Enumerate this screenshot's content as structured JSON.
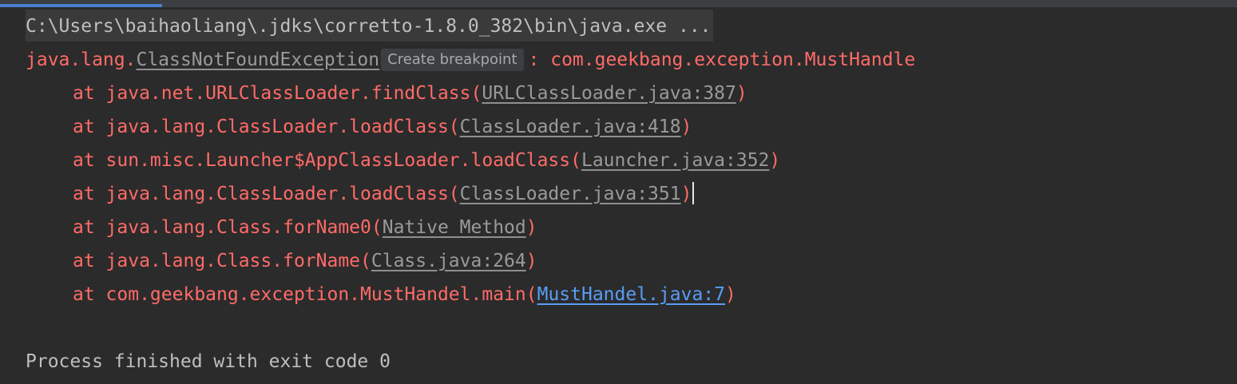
{
  "console": {
    "command_line": "C:\\Users\\baihaoliang\\.jdks\\corretto-1.8.0_382\\bin\\java.exe ...",
    "exception": {
      "package_prefix": "java.lang.",
      "class_link": "ClassNotFoundException",
      "breakpoint_hint": "Create breakpoint",
      "message": ": com.geekbang.exception.MustHandle"
    },
    "stack": [
      {
        "prefix": "at java.net.URLClassLoader.findClass(",
        "link": "URLClassLoader.java:387",
        "suffix": ")"
      },
      {
        "prefix": "at java.lang.ClassLoader.loadClass(",
        "link": "ClassLoader.java:418",
        "suffix": ")"
      },
      {
        "prefix": "at sun.misc.Launcher$AppClassLoader.loadClass(",
        "link": "Launcher.java:352",
        "suffix": ")"
      },
      {
        "prefix": "at java.lang.ClassLoader.loadClass(",
        "link": "ClassLoader.java:351",
        "suffix": ")"
      },
      {
        "prefix": "at java.lang.Class.forName0(",
        "link": "Native Method",
        "suffix": ")"
      },
      {
        "prefix": "at java.lang.Class.forName(",
        "link": "Class.java:264",
        "suffix": ")"
      },
      {
        "prefix": "at com.geekbang.exception.MustHandel.main(",
        "link": "MustHandel.java:7",
        "suffix": ")"
      }
    ],
    "exit_message": "Process finished with exit code 0"
  },
  "colors": {
    "background": "#2b2b2b",
    "error_text": "#ff6b68",
    "link_gray": "#9a9a9a",
    "link_blue": "#589df6",
    "accent_progress": "#4a7fd1"
  }
}
